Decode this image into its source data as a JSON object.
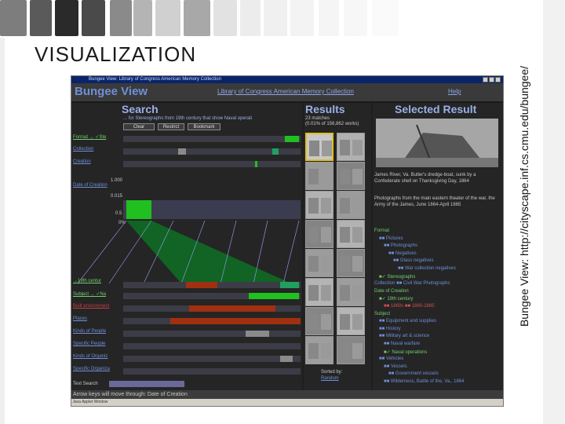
{
  "slide": {
    "title": "VISUALIZATION",
    "caption": "Bungee View:  http://cityscape.inf.cs.cmu.edu/bungee/"
  },
  "app": {
    "window_title": "Bungee View: Library of Congress American Memory Collection",
    "name": "Bungee View",
    "collection_link": "Library of Congress American Memory Collection",
    "help_link": "Help",
    "search": {
      "heading": "Search",
      "query": "... for  Stereographs  from  19th century  that show  Naval operati",
      "buttons": {
        "clear": "Clear",
        "restrict": "Restrict",
        "bookmark": "Bookmark"
      },
      "facets": [
        {
          "label": "Format",
          "value": "✓Ste"
        },
        {
          "label": "Collection"
        },
        {
          "label": "Creation"
        },
        {
          "label": "Date of Creation"
        }
      ],
      "axis_ticks": [
        "1.000",
        "0.015",
        "0.5",
        "0%"
      ],
      "lower_facets": [
        {
          "label": "Subject",
          "value": "✓Na"
        },
        {
          "label": "Built environment"
        },
        {
          "label": "Places"
        },
        {
          "label": "Kinds of People"
        },
        {
          "label": "Specific People"
        },
        {
          "label": "Kinds of Organiz"
        },
        {
          "label": "Specific Organiza"
        }
      ],
      "text_search_label": "Text Search",
      "highlight_label": "19th centur"
    },
    "results": {
      "heading": "Results",
      "matches": "23 matches",
      "ratio": "(0.01% of 156,862 works)",
      "sorted_by_label": "Sorted by:",
      "sorted_by_value": "Random",
      "thumbs": 16
    },
    "selected": {
      "heading": "Selected Result",
      "caption": "James River, Va.  Butler's dredge-boat, sunk by a Confederate shell on Thanksgiving Day, 1864",
      "collection_note": "Photographs from the main eastern theater of the war, the Army of the James, June 1864-April 1865",
      "tree": [
        {
          "text": "Format",
          "color": "#6fd06f",
          "indent": 0
        },
        {
          "text": "■■ Pictures",
          "color": "#6f8fd9",
          "indent": 1
        },
        {
          "text": "■■ Photographs",
          "color": "#6f8fd9",
          "indent": 2
        },
        {
          "text": "■■ Negatives",
          "color": "#6f8fd9",
          "indent": 3
        },
        {
          "text": "■■ Glass negatives",
          "color": "#6f8fd9",
          "indent": 4
        },
        {
          "text": "■■ War collection negatives",
          "color": "#6f8fd9",
          "indent": 5
        },
        {
          "text": "■✓ Stereographs",
          "color": "#6fd06f",
          "indent": 1
        },
        {
          "text": "Collection ■■ Civil War Photographs",
          "color": "#6f8fd9",
          "indent": 0
        },
        {
          "text": "Date of Creation",
          "color": "#6fd06f",
          "indent": 0
        },
        {
          "text": "■✓ 19th century",
          "color": "#6fd06f",
          "indent": 1
        },
        {
          "text": "■■ 1860s  ■■ 1860-1865",
          "color": "#d05050",
          "indent": 2
        },
        {
          "text": "Subject",
          "color": "#6fd06f",
          "indent": 0
        },
        {
          "text": "■■ Equipment and supplies",
          "color": "#6f8fd9",
          "indent": 1
        },
        {
          "text": "■■ History",
          "color": "#6f8fd9",
          "indent": 1
        },
        {
          "text": "■■ Military art & science",
          "color": "#6f8fd9",
          "indent": 1
        },
        {
          "text": "■■ Naval warfare",
          "color": "#6f8fd9",
          "indent": 2
        },
        {
          "text": "■✓ Naval operations",
          "color": "#6fd06f",
          "indent": 2
        },
        {
          "text": "■■ Vehicles",
          "color": "#6f8fd9",
          "indent": 1
        },
        {
          "text": "■■ Vessels",
          "color": "#6f8fd9",
          "indent": 2
        },
        {
          "text": "■■ Government vessels",
          "color": "#6f8fd9",
          "indent": 3
        },
        {
          "text": "■■ Wilderness, Battle of the, Va., 1864",
          "color": "#6f8fd9",
          "indent": 2
        }
      ]
    },
    "status": "Arrow keys will move through: Date of Creation",
    "statusbar": "Java Applet Window"
  },
  "colors": {
    "app_bg": "#1e1e1e",
    "accent_blue": "#6f8fd9",
    "accent_green": "#20c020",
    "accent_red": "#a03010"
  }
}
